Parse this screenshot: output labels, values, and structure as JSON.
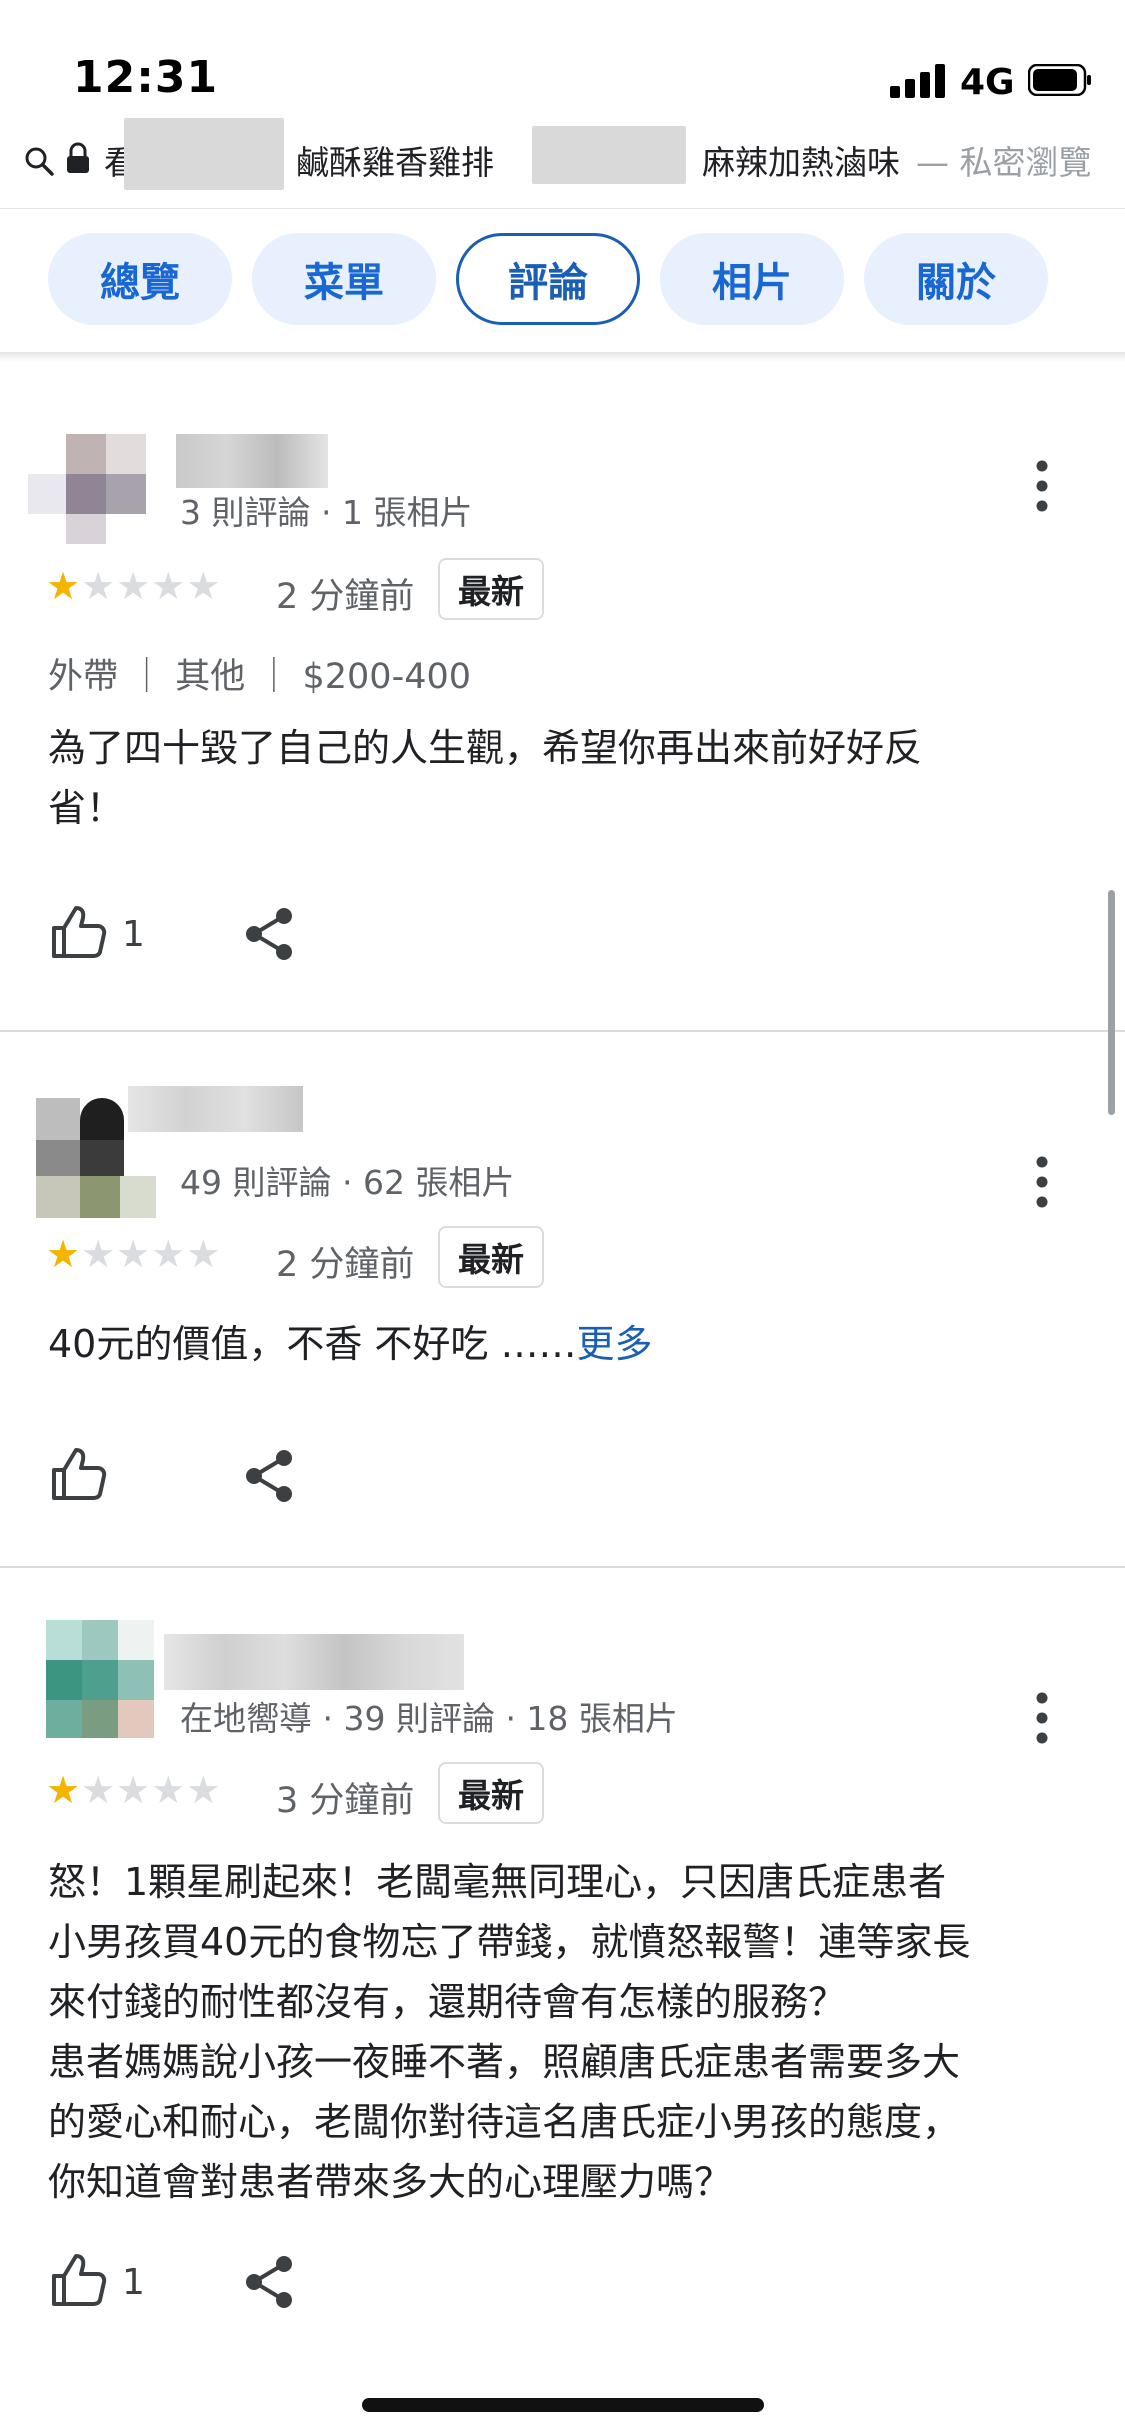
{
  "status": {
    "time": "12:31",
    "network": "4G"
  },
  "url_bar": {
    "part1": "看",
    "part2": "鹹酥雞香雞排",
    "part3": "麻辣加熱滷味",
    "suffix": "— 私密瀏覽"
  },
  "tabs": [
    {
      "label": "總覽"
    },
    {
      "label": "菜單"
    },
    {
      "label": "評論"
    },
    {
      "label": "相片"
    },
    {
      "label": "關於"
    }
  ],
  "reviews": [
    {
      "meta": "3 則評論 · 1 張相片",
      "rating": 1,
      "time": "2 分鐘前",
      "badge": "最新",
      "tags": "外帶 ｜ 其他 ｜ $200-400",
      "text_line1": "為了四十毀了自己的人生觀，希望你再出來前好好反",
      "text_line2": "省！",
      "likes": "1"
    },
    {
      "meta": "49 則評論 · 62 張相片",
      "rating": 1,
      "time": "2 分鐘前",
      "badge": "最新",
      "text": "40元的價值，不香 不好吃 ……",
      "more": "更多",
      "likes": ""
    },
    {
      "meta": "在地嚮導 · 39 則評論 · 18 張相片",
      "rating": 1,
      "time": "3 分鐘前",
      "badge": "最新",
      "lines": [
        "怒！1顆星刷起來！老闆毫無同理心，只因唐氏症患者",
        "小男孩買40元的食物忘了帶錢，就憤怒報警！連等家長",
        "來付錢的耐性都沒有，還期待會有怎樣的服務？",
        "患者媽媽說小孩一夜睡不著，照顧唐氏症患者需要多大",
        "的愛心和耐心，老闆你對待這名唐氏症小男孩的態度，",
        "你知道會對患者帶來多大的心理壓力嗎？"
      ],
      "likes": "1"
    }
  ],
  "icons": {
    "star": "★",
    "search": "search-icon",
    "lock": "lock-icon",
    "like": "thumbs-up-icon",
    "share": "share-icon",
    "more": "more-vert-icon"
  },
  "colors": {
    "accent": "#1a5fb4",
    "tab_bg": "#e8f0fe",
    "star": "#f4b400",
    "star_off": "#dadce0"
  }
}
